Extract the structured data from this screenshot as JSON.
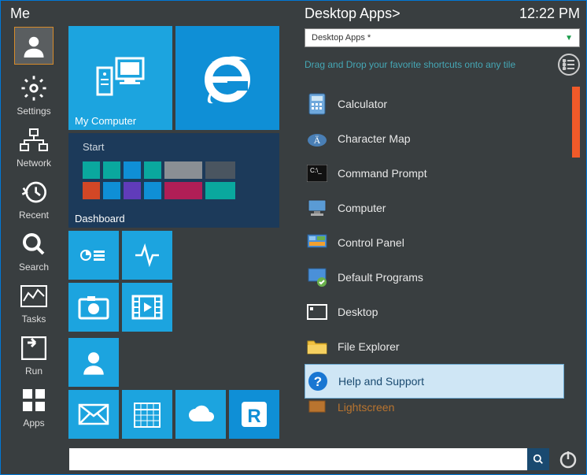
{
  "sidebar": {
    "header": "Me",
    "items": [
      {
        "label": "",
        "name": "avatar"
      },
      {
        "label": "Settings",
        "name": "settings"
      },
      {
        "label": "Network",
        "name": "network"
      },
      {
        "label": "Recent",
        "name": "recent"
      },
      {
        "label": "Search",
        "name": "search"
      },
      {
        "label": "Tasks",
        "name": "tasks"
      },
      {
        "label": "Run",
        "name": "run"
      },
      {
        "label": "Apps",
        "name": "apps"
      }
    ]
  },
  "tiles": {
    "computer": "My Computer",
    "dashboard_title": "Start",
    "dashboard_label": "Dashboard"
  },
  "right": {
    "header": "Desktop Apps>",
    "time": "12:22 PM",
    "dropdown": "Desktop Apps *",
    "hint": "Drag and Drop your favorite shortcuts onto any tile",
    "apps": [
      "Calculator",
      "Character Map",
      "Command Prompt",
      "Computer",
      "Control Panel",
      "Default Programs",
      "Desktop",
      "File Explorer",
      "Help and Support",
      "Lightscreen"
    ],
    "selected_index": 8
  },
  "search_placeholder": ""
}
